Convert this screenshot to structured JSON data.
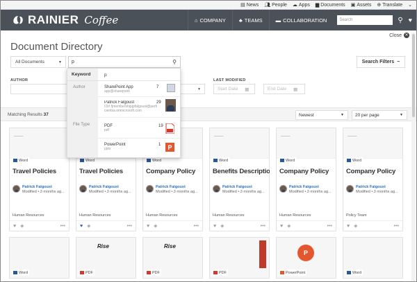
{
  "utility": {
    "news": "News",
    "people": "People",
    "apps": "Apps",
    "documents": "Documents",
    "assets": "Assets",
    "translate": "Translate"
  },
  "brand": {
    "name": "RAINIER",
    "name2": "Coffee"
  },
  "topnav": {
    "company": "COMPANY",
    "teams": "TEAMS",
    "collaboration": "COLLABORATION",
    "search_placeholder": "Search"
  },
  "close_label": "Close",
  "page_title": "Document Directory",
  "scope": "All Documents",
  "search_value": "p",
  "search_filters": "Search Filters",
  "filters": {
    "author_label": "AUTHOR",
    "last_modified_label": "LAST MODIFIED",
    "start_date": "Start Date",
    "end_date": "End Date"
  },
  "results": {
    "label": "Matching Results",
    "count": "37",
    "sort": "Newest",
    "per_page": "20 per page"
  },
  "dropdown": {
    "keyword_label": "Keyword",
    "keyword_value": "p",
    "author_section": "Author",
    "filetype_section": "File Type",
    "items": [
      {
        "name": "SharePoint App",
        "sub": "app@sharepoint",
        "count": "7"
      },
      {
        "name": "Patrick Falgoust",
        "sub": "i:0#.f|membership|pfalgoust@perficientsa.onmicrosoft.com",
        "count": "29"
      },
      {
        "name": "PDF",
        "sub": "pdf",
        "count": "19"
      },
      {
        "name": "PowerPoint",
        "sub": "pptx",
        "count": "1"
      }
    ]
  },
  "cards": [
    {
      "type": "Word",
      "title": "Travel Policies",
      "author": "Patrick Falgoust",
      "modified": "Modified • 3 months ag...",
      "dept": "Human Resources",
      "liked": false
    },
    {
      "type": "Word",
      "title": "Travel Policies",
      "author": "Patrick Falgoust",
      "modified": "Modified • 3 months ag...",
      "dept": "Human Resources",
      "liked": true
    },
    {
      "type": "Word",
      "title": "Company Policy",
      "author": "Patrick Falgoust",
      "modified": "Modified • 3 months ag...",
      "dept": "Human Resources",
      "liked": false
    },
    {
      "type": "Word",
      "title": "Benefits Description",
      "author": "Patrick Falgoust",
      "modified": "Modified • 3 months ag...",
      "dept": "Human Resources",
      "liked": false
    },
    {
      "type": "Word",
      "title": "Company Policy",
      "author": "Patrick Falgoust",
      "modified": "Modified • 3 months ag...",
      "dept": "Human Resources",
      "liked": false
    },
    {
      "type": "Word",
      "title": "Company Policy",
      "author": "Patrick Falgoust",
      "modified": "Modified • 3 months ag...",
      "dept": "Policy Team",
      "liked": false
    }
  ],
  "cards_row2": [
    {
      "type": "Word"
    },
    {
      "type": "PDF",
      "thumb_text": "Rise"
    },
    {
      "type": "PDF",
      "thumb_text": "Rise"
    },
    {
      "type": "PDF"
    },
    {
      "type": "PowerPoint"
    },
    {
      "type": "Word"
    }
  ],
  "colors": {
    "header_bg": "#4a5159",
    "link_blue": "#2b73c4",
    "word_blue": "#2b579a",
    "pdf_red": "#d9362b",
    "ppt_orange": "#e4572e"
  }
}
